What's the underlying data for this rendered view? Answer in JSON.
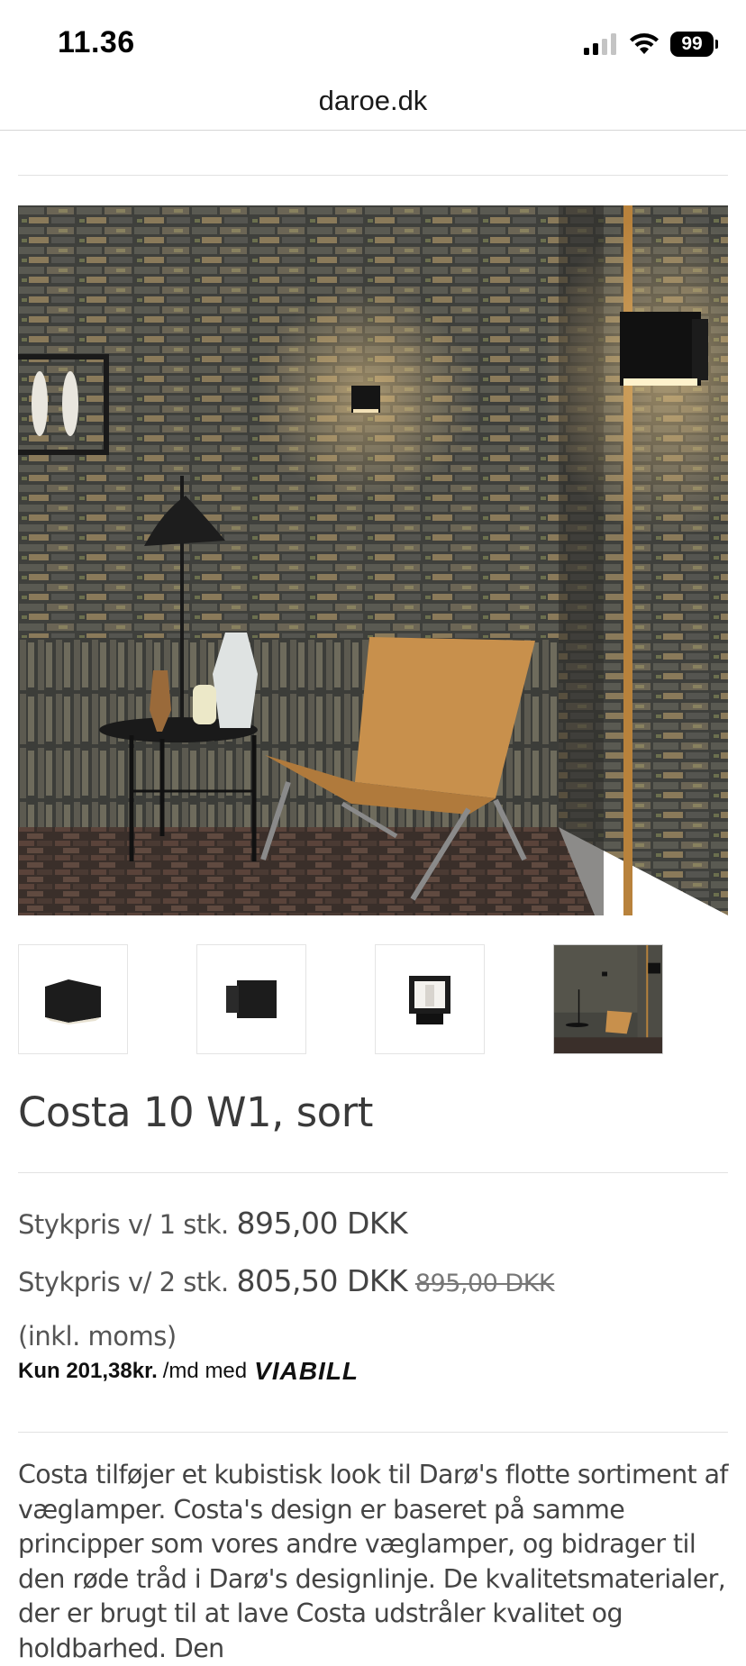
{
  "status_bar": {
    "time": "11.36",
    "battery": "99",
    "icons": [
      "cellular-signal-icon",
      "wifi-icon",
      "battery-icon"
    ]
  },
  "browser": {
    "url": "daroe.dk"
  },
  "gallery": {
    "main_image": "Costa 10 W1 wall lamps in a brick-walled room with leather lounge chair",
    "thumbnails": [
      "lamp-front-thumbnail",
      "lamp-side-thumbnail",
      "lamp-top-thumbnail",
      "room-scene-thumbnail"
    ],
    "selected_index": 3
  },
  "product": {
    "title": "Costa 10 W1, sort",
    "price_1_label": "Stykpris v/ 1 stk.",
    "price_1_value": "895,00 DKK",
    "price_2_label": "Stykpris v/ 2 stk.",
    "price_2_value": "805,50 DKK",
    "price_2_old": "895,00 DKK",
    "vat_note": "(inkl. moms)",
    "viabill_amount": "Kun 201,38kr.",
    "viabill_suffix": "/md med",
    "viabill_logo": "VIABILL",
    "description": "Costa tilføjer et kubistisk look til Darø's flotte sortiment af væglamper. Costa's design er baseret på samme principper som vores andre væglamper, og bidrager til den røde tråd i Darø's designlinje. De kvalitetsmaterialer, der er brugt til at lave Costa udstråler kvalitet og holdbarhed. Den"
  },
  "colors": {
    "text": "#333333",
    "divider": "#e2e2e2",
    "lamp_black": "#1c1c1c",
    "chair_leather": "#c8904c",
    "brick_dark": "#4a4a44"
  }
}
